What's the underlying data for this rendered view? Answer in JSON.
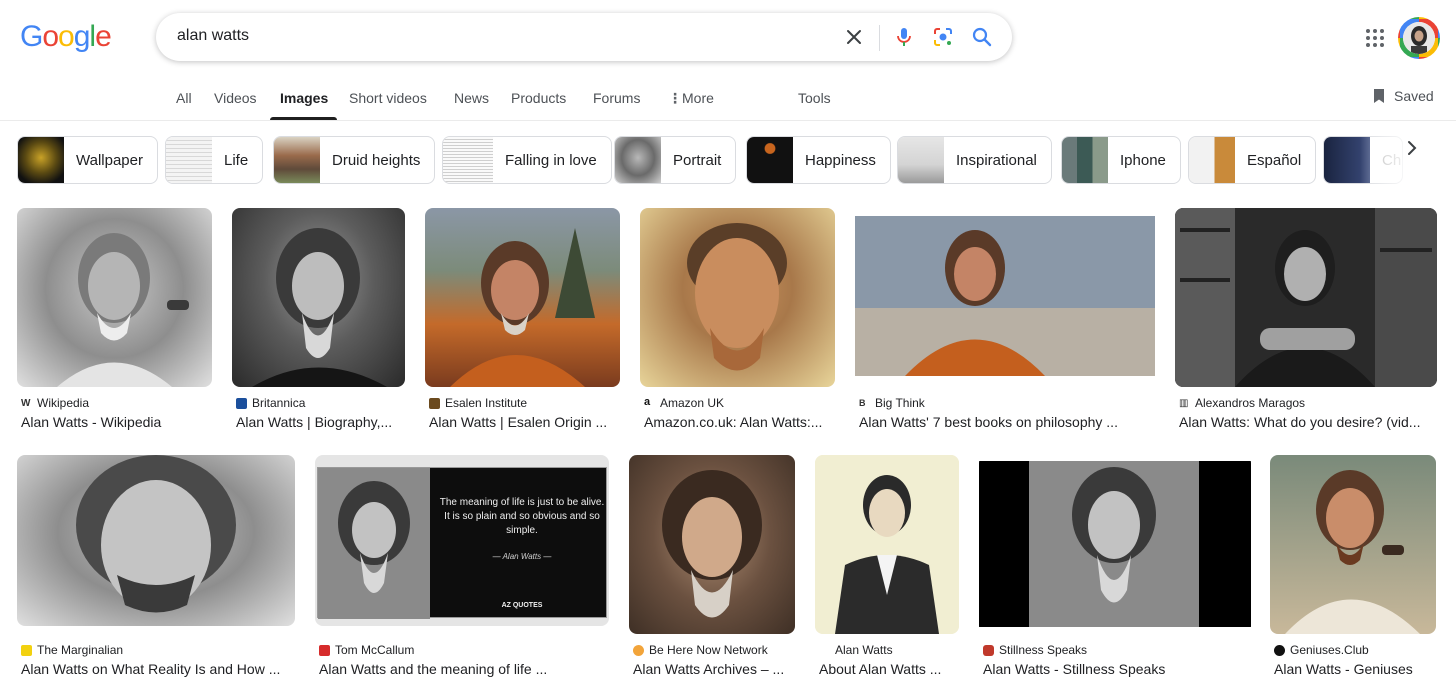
{
  "search": {
    "query": "alan watts"
  },
  "logo": [
    "G",
    "o",
    "o",
    "g",
    "l",
    "e"
  ],
  "colors": {
    "blue": "#4285f4",
    "red": "#ea4335",
    "yellow": "#fbbc05",
    "green": "#34a853"
  },
  "nav": {
    "tabs": [
      "All",
      "Videos",
      "Images",
      "Short videos",
      "News",
      "Products",
      "Forums",
      "More",
      "Tools"
    ],
    "active": "Images",
    "saved": "Saved"
  },
  "chips": [
    "Wallpaper",
    "Life",
    "Druid heights",
    "Falling in love",
    "Portrait",
    "Happiness",
    "Inspirational",
    "Iphone",
    "Español",
    "Ch"
  ],
  "results": [
    {
      "source": "Wikipedia",
      "title": "Alan Watts - Wikipedia"
    },
    {
      "source": "Britannica",
      "title": "Alan Watts | Biography,..."
    },
    {
      "source": "Esalen Institute",
      "title": "Alan Watts | Esalen Origin ..."
    },
    {
      "source": "Amazon UK",
      "title": "Amazon.co.uk: Alan Watts:..."
    },
    {
      "source": "Big Think",
      "title": "Alan Watts' 7 best books on philosophy ..."
    },
    {
      "source": "Alexandros Maragos",
      "title": "Alan Watts: What do you desire? (vid..."
    },
    {
      "source": "The Marginalian",
      "title": "Alan Watts on What Reality Is and How ..."
    },
    {
      "source": "Tom McCallum",
      "title": "Alan Watts and the meaning of life ..."
    },
    {
      "source": "Be Here Now Network",
      "title": "Alan Watts Archives – ..."
    },
    {
      "source": "Alan Watts",
      "title": "About Alan Watts ..."
    },
    {
      "source": "Stillness Speaks",
      "title": "Alan Watts - Stillness Speaks"
    },
    {
      "source": "Geniuses.Club",
      "title": "Alan Watts - Geniuses"
    }
  ],
  "quote_image": {
    "text": "The meaning of life is just to be alive. It is so plain and so obvious and so simple.",
    "attribution": "— Alan Watts —",
    "brand": "AZ QUOTES"
  }
}
